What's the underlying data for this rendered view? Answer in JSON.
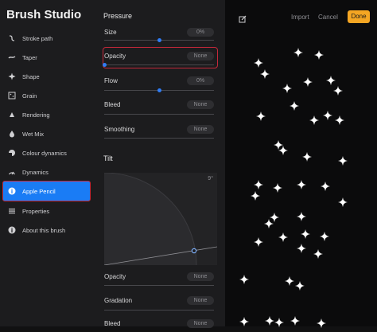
{
  "app": {
    "title": "Brush Studio"
  },
  "sidebar": {
    "items": [
      {
        "label": "Stroke path",
        "icon": "stroke-path-icon"
      },
      {
        "label": "Taper",
        "icon": "taper-icon"
      },
      {
        "label": "Shape",
        "icon": "shape-icon"
      },
      {
        "label": "Grain",
        "icon": "grain-icon"
      },
      {
        "label": "Rendering",
        "icon": "rendering-icon"
      },
      {
        "label": "Wet Mix",
        "icon": "wet-mix-icon"
      },
      {
        "label": "Colour dynamics",
        "icon": "colour-dynamics-icon"
      },
      {
        "label": "Dynamics",
        "icon": "dynamics-icon"
      },
      {
        "label": "Apple Pencil",
        "icon": "apple-pencil-icon",
        "selected": true
      },
      {
        "label": "Properties",
        "icon": "properties-icon"
      },
      {
        "label": "About this brush",
        "icon": "about-icon"
      }
    ]
  },
  "pressure": {
    "title": "Pressure",
    "params": [
      {
        "label": "Size",
        "value": "0%",
        "level": 0.5
      },
      {
        "label": "Opacity",
        "value": "None",
        "level": 0.0
      },
      {
        "label": "Flow",
        "value": "0%",
        "level": 0.5
      },
      {
        "label": "Bleed",
        "value": "None"
      },
      {
        "label": "Smoothing",
        "value": "None"
      }
    ]
  },
  "tilt": {
    "title": "Tilt",
    "angle_label": "9°",
    "params": [
      {
        "label": "Opacity",
        "value": "None"
      },
      {
        "label": "Gradation",
        "value": "None"
      },
      {
        "label": "Bleed",
        "value": "None"
      }
    ]
  },
  "toolbar": {
    "import_label": "Import",
    "cancel_label": "Cancel",
    "done_label": "Done"
  },
  "colors": {
    "accent": "#1a7cf5",
    "done": "#f5a623",
    "highlight": "#c3283a"
  }
}
